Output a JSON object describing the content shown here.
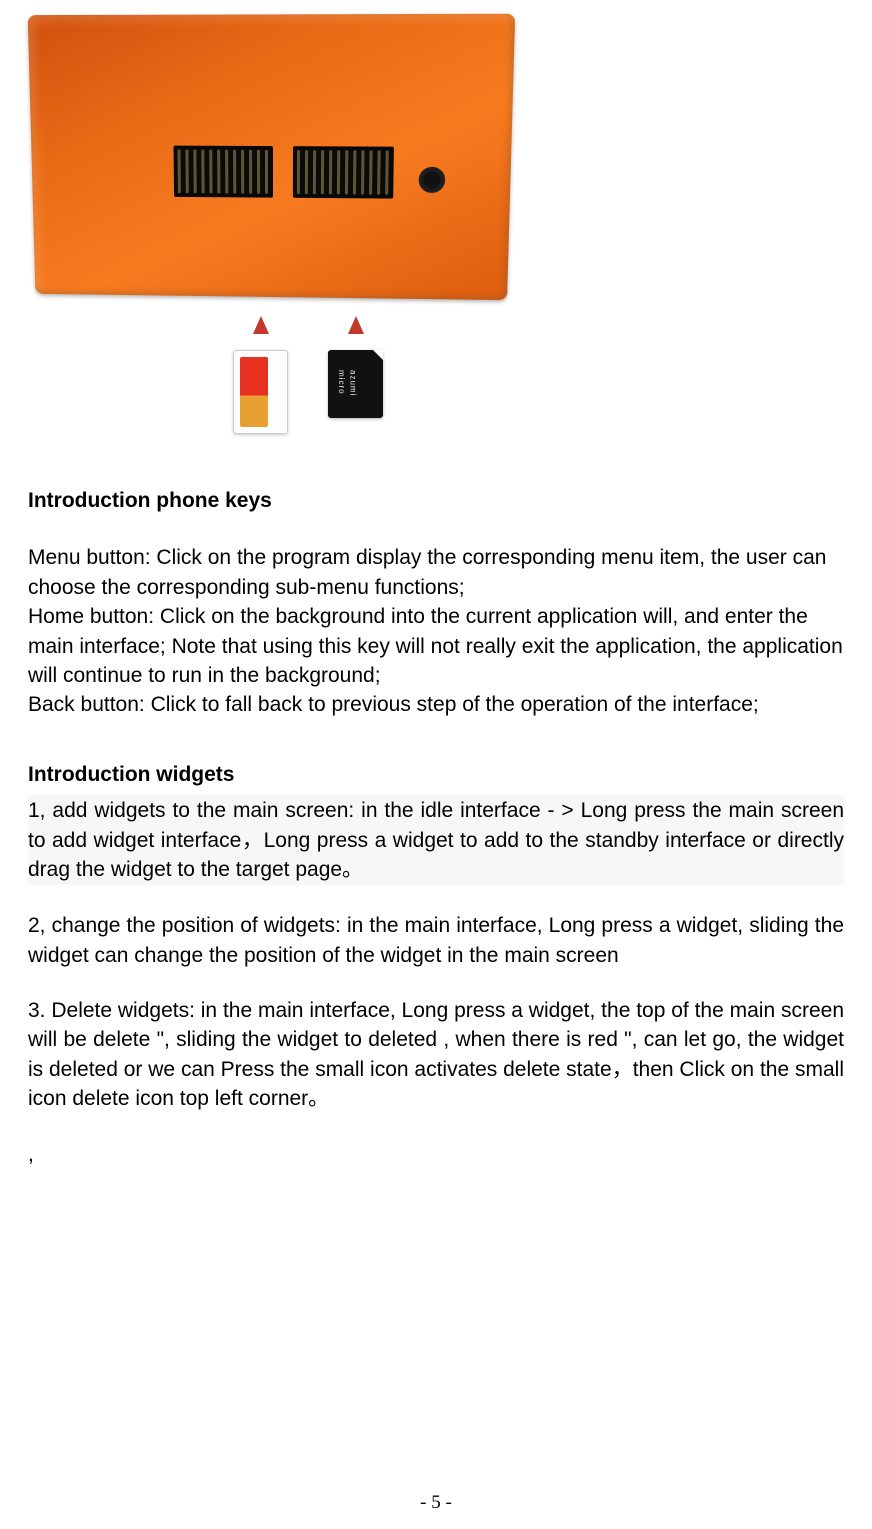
{
  "image": {
    "sim_label": "azumi micro"
  },
  "section1": {
    "heading": "Introduction phone keys",
    "p1": "Menu button: Click on the program display the corresponding menu item, the user can choose the corresponding sub-menu functions;",
    "p2": "Home button: Click on the background into the current application will, and enter the main interface; Note that using this key will not really exit the application, the application will continue to run in the background;",
    "p3": "Back button: Click to fall back to previous step of the operation of the interface;"
  },
  "section2": {
    "heading": "Introduction widgets",
    "p1": "1, add widgets to the main screen: in the idle interface - > Long press the main screen to add widget interface，Long press a widget to add to the standby interface or directly drag the widget to the target page。",
    "p2": "2, change the position of widgets: in the main interface, Long press a widget, sliding the widget can change the position of the widget in the main screen",
    "p3": "3. Delete widgets: in the main interface, Long press a widget, the top of the main screen will be delete \", sliding the widget to deleted , when there is red \", can let go, the widget is deleted or we can Press the small icon activates delete state，then Click on the small icon delete icon top left corner。",
    "trailing": ","
  },
  "footer": {
    "page_number": "- 5 -"
  }
}
